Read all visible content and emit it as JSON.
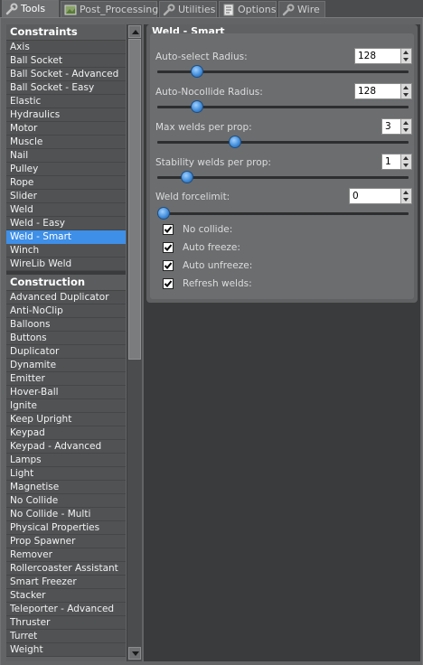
{
  "tabs": [
    {
      "label": "Tools",
      "icon": "wrench-icon",
      "active": true
    },
    {
      "label": "Post_Processing",
      "icon": "image-icon",
      "active": false
    },
    {
      "label": "Utilities",
      "icon": "wrench-icon",
      "active": false
    },
    {
      "label": "Options",
      "icon": "options-icon",
      "active": false
    },
    {
      "label": "Wire",
      "icon": "wrench-icon",
      "active": false
    }
  ],
  "categories": [
    {
      "header": "Constraints",
      "items": [
        "Axis",
        "Ball Socket",
        "Ball Socket - Advanced",
        "Ball Socket - Easy",
        "Elastic",
        "Hydraulics",
        "Motor",
        "Muscle",
        "Nail",
        "Pulley",
        "Rope",
        "Slider",
        "Weld",
        "Weld - Easy",
        "Weld - Smart",
        "Winch",
        "WireLib Weld"
      ]
    },
    {
      "header": "Construction",
      "items": [
        "Advanced Duplicator",
        "Anti-NoClip",
        "Balloons",
        "Buttons",
        "Duplicator",
        "Dynamite",
        "Emitter",
        "Hover-Ball",
        "Ignite",
        "Keep Upright",
        "Keypad",
        "Keypad - Advanced",
        "Lamps",
        "Light",
        "Magnetise",
        "No Collide",
        "No Collide - Multi",
        "Physical Properties",
        "Prop Spawner",
        "Remover",
        "Rollercoaster Assistant",
        "Smart Freezer",
        "Stacker",
        "Teleporter - Advanced",
        "Thruster",
        "Turret",
        "Weight"
      ]
    }
  ],
  "selected_item": "Weld - Smart",
  "panel": {
    "title": "Weld - Smart",
    "fields": [
      {
        "label": "Auto-select Radius:",
        "value": "128",
        "slider_fraction": 0.14
      },
      {
        "label": "Auto-Nocollide Radius:",
        "value": "128",
        "slider_fraction": 0.14
      },
      {
        "label": "Max welds per prop:",
        "value": "3",
        "slider_fraction": 0.3
      },
      {
        "label": "Stability welds per prop:",
        "value": "1",
        "slider_fraction": 0.1
      },
      {
        "label": "Weld forcelimit:",
        "value": "0",
        "slider_fraction": 0.0
      }
    ],
    "checkboxes": [
      {
        "label": "No collide:",
        "checked": true
      },
      {
        "label": "Auto freeze:",
        "checked": true
      },
      {
        "label": "Auto unfreeze:",
        "checked": true
      },
      {
        "label": "Refresh welds:",
        "checked": true
      }
    ]
  },
  "colors": {
    "selection": "#3e8fe8",
    "panel": "#626466",
    "background": "#3a3b3c"
  }
}
